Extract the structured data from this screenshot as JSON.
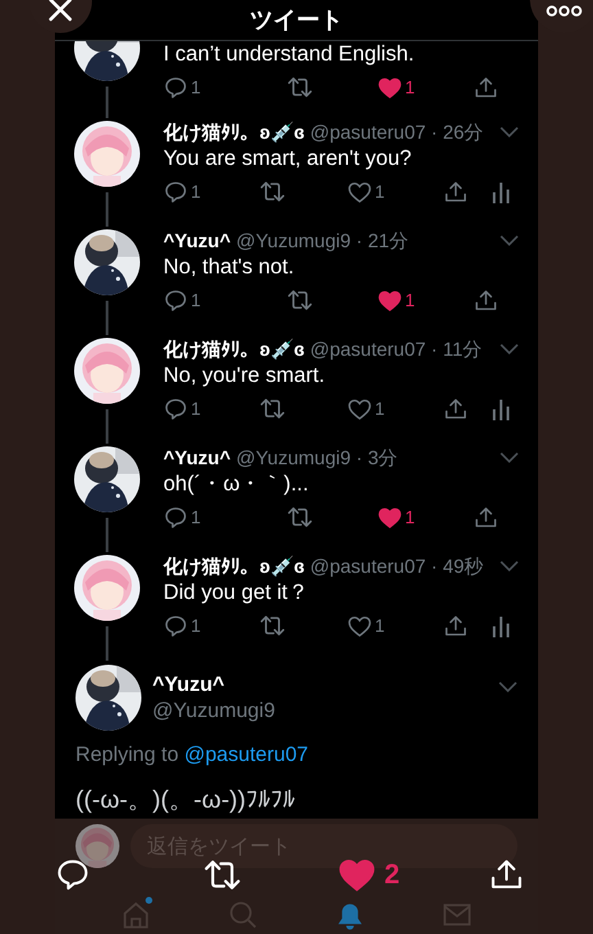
{
  "header": {
    "title": "ツイート"
  },
  "tweets": [
    {
      "text": "I can’t understand English.",
      "replies": "1",
      "likes": "1",
      "liked": true,
      "analytics": false
    },
    {
      "name": "化け猫ﾀﾘ。ʚ💉ɞ",
      "meta": "@pasuteru07 · 26分",
      "text": "You are smart, aren't you?",
      "replies": "1",
      "likes": "1",
      "liked": false,
      "analytics": true
    },
    {
      "name": "^Yuzu^",
      "meta": "@Yuzumugi9 · 21分",
      "text": "No, that's not.",
      "replies": "1",
      "likes": "1",
      "liked": true,
      "analytics": false
    },
    {
      "name": "化け猫ﾀﾘ。ʚ💉ɞ",
      "meta": "@pasuteru07 · 11分",
      "text": "No, you're smart.",
      "replies": "1",
      "likes": "1",
      "liked": false,
      "analytics": true
    },
    {
      "name": "^Yuzu^",
      "meta": "@Yuzumugi9 · 3分",
      "text": "oh(´・ω・｀)...",
      "replies": "1",
      "likes": "1",
      "liked": true,
      "analytics": false
    },
    {
      "name": "化け猫ﾀﾘ。ʚ💉ɞ",
      "meta": "@pasuteru07 · 49秒",
      "text": "Did you get it？",
      "replies": "1",
      "likes": "1",
      "liked": false,
      "analytics": true
    }
  ],
  "main_tweet": {
    "name": "^Yuzu^",
    "handle": "@Yuzumugi9",
    "replying_prefix": "Replying to",
    "replying_to": "@pasuteru07",
    "text": "((-ω-。)(。-ω-))ﾌﾙﾌﾙ"
  },
  "reply_bar": {
    "placeholder": "返信をツイート"
  },
  "viewer_actions": {
    "likes": "2",
    "liked": true
  },
  "tab_bar": [
    {
      "kind": "home",
      "selected": false,
      "badge": true
    },
    {
      "kind": "search",
      "selected": false,
      "badge": false
    },
    {
      "kind": "notifications",
      "selected": true,
      "badge": false
    },
    {
      "kind": "messages",
      "selected": false,
      "badge": false
    }
  ]
}
